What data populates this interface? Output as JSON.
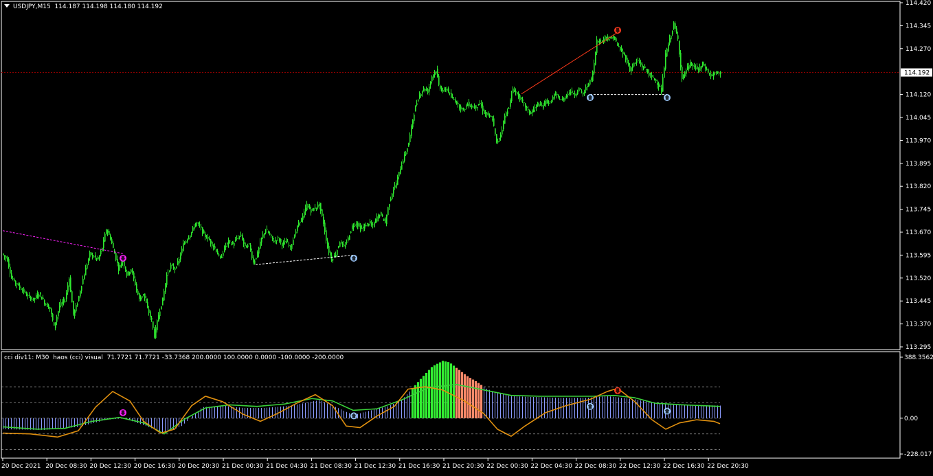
{
  "colors": {
    "background": "#000000",
    "frame": "#ffffff",
    "bull_candle": "#2ee82e",
    "bear_candle": "#2ee82e",
    "price_line": "#8b0000",
    "price_label_bg": "#ffffff",
    "price_label_fg": "#000000",
    "down_arrow_red": "#ff3b1f",
    "down_arrow_magenta": "#ff22ff",
    "up_arrow_blue": "#9ecbff",
    "hist_neutral": "#8c9cff",
    "hist_bull": "#33ee33",
    "hist_bear": "#ff8a6a",
    "cci_line": "#e0900f",
    "signal_line": "#3ad13a",
    "level_line": "#c8c8c8",
    "trend_red": "#ff3a1a",
    "trend_magenta": "#ff22ff",
    "trend_white": "#ffffff"
  },
  "main_header": {
    "symbol_tf": "USDJPY,M15",
    "ohlc": "114.187 114.198 114.180 114.192"
  },
  "indicator_header": {
    "text": "cci div11: M30  haos (cci) visual  71.7721 71.7721 -33.7368 200.0000 100.0000 0.0000 -100.0000 -200.0000"
  },
  "chart_data": [
    {
      "type": "candlestick",
      "symbol": "USDJPY",
      "timeframe": "M15",
      "y_ticks": [
        "114.420",
        "114.345",
        "114.270",
        "114.120",
        "114.045",
        "113.970",
        "113.895",
        "113.820",
        "113.745",
        "113.670",
        "113.595",
        "113.520",
        "113.445",
        "113.370",
        "113.295"
      ],
      "ylim": [
        113.295,
        114.42
      ],
      "current_price": "114.192",
      "x_ticks": [
        "20 Dec 2021",
        "20 Dec 08:30",
        "20 Dec 12:30",
        "20 Dec 16:30",
        "20 Dec 20:30",
        "21 Dec 00:30",
        "21 Dec 04:30",
        "21 Dec 08:30",
        "21 Dec 12:30",
        "21 Dec 16:30",
        "21 Dec 20:30",
        "22 Dec 00:30",
        "22 Dec 04:30",
        "22 Dec 08:30",
        "22 Dec 12:30",
        "22 Dec 16:30",
        "22 Dec 20:30"
      ],
      "price_path": [
        [
          0,
          113.6
        ],
        [
          8,
          113.58
        ],
        [
          14,
          113.52
        ],
        [
          22,
          113.5
        ],
        [
          30,
          113.48
        ],
        [
          38,
          113.46
        ],
        [
          46,
          113.45
        ],
        [
          54,
          113.47
        ],
        [
          62,
          113.44
        ],
        [
          70,
          113.42
        ],
        [
          76,
          113.36
        ],
        [
          84,
          113.43
        ],
        [
          92,
          113.45
        ],
        [
          98,
          113.52
        ],
        [
          104,
          113.4
        ],
        [
          110,
          113.44
        ],
        [
          116,
          113.5
        ],
        [
          122,
          113.55
        ],
        [
          128,
          113.6
        ],
        [
          134,
          113.59
        ],
        [
          140,
          113.58
        ],
        [
          146,
          113.62
        ],
        [
          152,
          113.68
        ],
        [
          158,
          113.65
        ],
        [
          164,
          113.6
        ],
        [
          170,
          113.55
        ],
        [
          176,
          113.58
        ],
        [
          182,
          113.53
        ],
        [
          188,
          113.55
        ],
        [
          194,
          113.5
        ],
        [
          200,
          113.45
        ],
        [
          206,
          113.47
        ],
        [
          212,
          113.42
        ],
        [
          218,
          113.38
        ],
        [
          222,
          113.33
        ],
        [
          228,
          113.4
        ],
        [
          234,
          113.45
        ],
        [
          240,
          113.53
        ],
        [
          246,
          113.56
        ],
        [
          252,
          113.55
        ],
        [
          258,
          113.58
        ],
        [
          264,
          113.63
        ],
        [
          270,
          113.65
        ],
        [
          276,
          113.67
        ],
        [
          282,
          113.7
        ],
        [
          288,
          113.69
        ],
        [
          294,
          113.66
        ],
        [
          300,
          113.65
        ],
        [
          306,
          113.63
        ],
        [
          312,
          113.61
        ],
        [
          318,
          113.58
        ],
        [
          324,
          113.62
        ],
        [
          330,
          113.64
        ],
        [
          336,
          113.63
        ],
        [
          342,
          113.65
        ],
        [
          348,
          113.66
        ],
        [
          354,
          113.62
        ],
        [
          360,
          113.63
        ],
        [
          366,
          113.57
        ],
        [
          372,
          113.6
        ],
        [
          378,
          113.65
        ],
        [
          384,
          113.68
        ],
        [
          390,
          113.66
        ],
        [
          396,
          113.64
        ],
        [
          402,
          113.65
        ],
        [
          408,
          113.63
        ],
        [
          414,
          113.64
        ],
        [
          420,
          113.62
        ],
        [
          426,
          113.66
        ],
        [
          432,
          113.7
        ],
        [
          438,
          113.72
        ],
        [
          444,
          113.76
        ],
        [
          450,
          113.74
        ],
        [
          456,
          113.75
        ],
        [
          462,
          113.76
        ],
        [
          468,
          113.7
        ],
        [
          474,
          113.62
        ],
        [
          480,
          113.58
        ],
        [
          486,
          113.6
        ],
        [
          492,
          113.64
        ],
        [
          498,
          113.62
        ],
        [
          504,
          113.65
        ],
        [
          510,
          113.69
        ],
        [
          516,
          113.7
        ],
        [
          522,
          113.68
        ],
        [
          528,
          113.69
        ],
        [
          534,
          113.7
        ],
        [
          540,
          113.69
        ],
        [
          546,
          113.72
        ],
        [
          552,
          113.73
        ],
        [
          558,
          113.7
        ],
        [
          562,
          113.75
        ],
        [
          568,
          113.8
        ],
        [
          574,
          113.83
        ],
        [
          580,
          113.88
        ],
        [
          586,
          113.92
        ],
        [
          592,
          113.96
        ],
        [
          598,
          114.04
        ],
        [
          602,
          114.08
        ],
        [
          608,
          114.12
        ],
        [
          614,
          114.14
        ],
        [
          620,
          114.13
        ],
        [
          626,
          114.18
        ],
        [
          632,
          114.2
        ],
        [
          636,
          114.15
        ],
        [
          642,
          114.13
        ],
        [
          648,
          114.14
        ],
        [
          654,
          114.11
        ],
        [
          660,
          114.1
        ],
        [
          666,
          114.08
        ],
        [
          672,
          114.07
        ],
        [
          678,
          114.09
        ],
        [
          684,
          114.08
        ],
        [
          690,
          114.08
        ],
        [
          696,
          114.09
        ],
        [
          702,
          114.06
        ],
        [
          708,
          114.05
        ],
        [
          714,
          114.04
        ],
        [
          720,
          113.96
        ],
        [
          726,
          113.99
        ],
        [
          732,
          114.05
        ],
        [
          738,
          114.08
        ],
        [
          744,
          114.14
        ],
        [
          750,
          114.12
        ],
        [
          756,
          114.1
        ],
        [
          762,
          114.08
        ],
        [
          768,
          114.06
        ],
        [
          774,
          114.07
        ],
        [
          780,
          114.09
        ],
        [
          786,
          114.08
        ],
        [
          792,
          114.1
        ],
        [
          798,
          114.09
        ],
        [
          804,
          114.12
        ],
        [
          810,
          114.11
        ],
        [
          816,
          114.1
        ],
        [
          822,
          114.12
        ],
        [
          828,
          114.13
        ],
        [
          834,
          114.12
        ],
        [
          840,
          114.14
        ],
        [
          846,
          114.12
        ],
        [
          852,
          114.15
        ],
        [
          858,
          114.17
        ],
        [
          862,
          114.22
        ],
        [
          866,
          114.3
        ],
        [
          872,
          114.29
        ],
        [
          878,
          114.31
        ],
        [
          884,
          114.3
        ],
        [
          890,
          114.31
        ],
        [
          896,
          114.28
        ],
        [
          902,
          114.26
        ],
        [
          908,
          114.24
        ],
        [
          914,
          114.2
        ],
        [
          920,
          114.22
        ],
        [
          926,
          114.23
        ],
        [
          932,
          114.21
        ],
        [
          938,
          114.2
        ],
        [
          944,
          114.18
        ],
        [
          950,
          114.17
        ],
        [
          956,
          114.15
        ],
        [
          960,
          114.13
        ],
        [
          966,
          114.25
        ],
        [
          972,
          114.3
        ],
        [
          978,
          114.35
        ],
        [
          984,
          114.3
        ],
        [
          990,
          114.17
        ],
        [
          996,
          114.2
        ],
        [
          1002,
          114.22
        ],
        [
          1008,
          114.21
        ],
        [
          1014,
          114.2
        ],
        [
          1020,
          114.22
        ],
        [
          1026,
          114.2
        ],
        [
          1032,
          114.18
        ],
        [
          1038,
          114.19
        ],
        [
          1044,
          114.19
        ]
      ],
      "arrows": [
        {
          "kind": "down",
          "color": "down_arrow_magenta",
          "bar": 175,
          "price": 113.585
        },
        {
          "kind": "up",
          "color": "up_arrow_blue",
          "bar": 511,
          "price": 113.585
        },
        {
          "kind": "up",
          "color": "up_arrow_blue",
          "bar": 855,
          "price": 114.11
        },
        {
          "kind": "down",
          "color": "down_arrow_red",
          "bar": 895,
          "price": 114.33
        },
        {
          "kind": "up",
          "color": "up_arrow_blue",
          "bar": 967,
          "price": 114.11
        }
      ],
      "trend_lines": [
        {
          "color": "trend_magenta",
          "dashed": true,
          "from": [
            0,
            113.675
          ],
          "to": [
            175,
            113.6
          ]
        },
        {
          "color": "trend_white",
          "dashed": true,
          "from": [
            368,
            113.564
          ],
          "to": [
            511,
            113.595
          ]
        },
        {
          "color": "trend_red",
          "dashed": false,
          "from": [
            755,
            114.122
          ],
          "to": [
            895,
            114.323
          ]
        },
        {
          "color": "trend_white",
          "dashed": true,
          "from": [
            855,
            114.12
          ],
          "to": [
            967,
            114.12
          ]
        }
      ]
    },
    {
      "type": "bar",
      "name": "cci div11: M30",
      "y_ticks": [
        "388.3562",
        "0.00",
        "-228.017"
      ],
      "ylim": [
        -228.017,
        388.3562
      ],
      "levels": [
        200,
        100,
        0,
        -100,
        -200
      ],
      "histogram": [
        [
          0,
          -70
        ],
        [
          60,
          -75
        ],
        [
          110,
          -55
        ],
        [
          150,
          -10
        ],
        [
          175,
          0
        ],
        [
          205,
          -45
        ],
        [
          235,
          -95
        ],
        [
          260,
          -50
        ],
        [
          290,
          70
        ],
        [
          320,
          80
        ],
        [
          350,
          65
        ],
        [
          380,
          65
        ],
        [
          420,
          80
        ],
        [
          460,
          115
        ],
        [
          480,
          80
        ],
        [
          510,
          20
        ],
        [
          540,
          55
        ],
        [
          560,
          75
        ],
        [
          580,
          115
        ],
        [
          592,
          170
        ],
        [
          610,
          260
        ],
        [
          625,
          330
        ],
        [
          640,
          365
        ],
        [
          650,
          355
        ],
        [
          660,
          320
        ],
        [
          675,
          270
        ],
        [
          690,
          230
        ],
        [
          705,
          185
        ],
        [
          720,
          160
        ],
        [
          740,
          140
        ],
        [
          770,
          135
        ],
        [
          810,
          130
        ],
        [
          850,
          130
        ],
        [
          880,
          140
        ],
        [
          900,
          130
        ],
        [
          920,
          120
        ],
        [
          945,
          100
        ],
        [
          970,
          85
        ],
        [
          1000,
          85
        ],
        [
          1044,
          80
        ]
      ],
      "hist_bull_range": [
        594,
        657
      ],
      "hist_bear_range": [
        657,
        697
      ],
      "cci_line": [
        [
          0,
          -95
        ],
        [
          40,
          -100
        ],
        [
          80,
          -120
        ],
        [
          110,
          -80
        ],
        [
          135,
          70
        ],
        [
          160,
          170
        ],
        [
          185,
          110
        ],
        [
          205,
          -20
        ],
        [
          230,
          -95
        ],
        [
          250,
          -70
        ],
        [
          275,
          80
        ],
        [
          295,
          140
        ],
        [
          320,
          105
        ],
        [
          350,
          25
        ],
        [
          375,
          -20
        ],
        [
          400,
          30
        ],
        [
          430,
          100
        ],
        [
          455,
          150
        ],
        [
          480,
          80
        ],
        [
          500,
          -50
        ],
        [
          520,
          -60
        ],
        [
          545,
          15
        ],
        [
          570,
          75
        ],
        [
          590,
          185
        ],
        [
          615,
          200
        ],
        [
          640,
          180
        ],
        [
          670,
          115
        ],
        [
          700,
          30
        ],
        [
          720,
          -70
        ],
        [
          740,
          -115
        ],
        [
          760,
          -50
        ],
        [
          790,
          35
        ],
        [
          820,
          80
        ],
        [
          855,
          120
        ],
        [
          880,
          170
        ],
        [
          895,
          190
        ],
        [
          920,
          105
        ],
        [
          945,
          -10
        ],
        [
          965,
          -70
        ],
        [
          985,
          -30
        ],
        [
          1010,
          -10
        ],
        [
          1035,
          -20
        ],
        [
          1044,
          -35
        ]
      ],
      "signal_line": [
        [
          0,
          -55
        ],
        [
          50,
          -70
        ],
        [
          90,
          -65
        ],
        [
          130,
          -20
        ],
        [
          170,
          5
        ],
        [
          205,
          -30
        ],
        [
          235,
          -100
        ],
        [
          265,
          -5
        ],
        [
          295,
          65
        ],
        [
          330,
          85
        ],
        [
          370,
          75
        ],
        [
          410,
          90
        ],
        [
          450,
          125
        ],
        [
          480,
          110
        ],
        [
          510,
          50
        ],
        [
          545,
          60
        ],
        [
          580,
          115
        ],
        [
          620,
          195
        ],
        [
          660,
          215
        ],
        [
          700,
          180
        ],
        [
          740,
          145
        ],
        [
          780,
          140
        ],
        [
          820,
          140
        ],
        [
          860,
          140
        ],
        [
          890,
          145
        ],
        [
          920,
          130
        ],
        [
          950,
          95
        ],
        [
          990,
          85
        ],
        [
          1044,
          75
        ]
      ],
      "arrows": [
        {
          "kind": "down",
          "color": "down_arrow_magenta",
          "bar": 175,
          "value": 35
        },
        {
          "kind": "up",
          "color": "up_arrow_blue",
          "bar": 511,
          "value": 15
        },
        {
          "kind": "up",
          "color": "up_arrow_blue",
          "bar": 855,
          "value": 75
        },
        {
          "kind": "down",
          "color": "down_arrow_red",
          "bar": 895,
          "value": 175
        },
        {
          "kind": "up",
          "color": "up_arrow_blue",
          "bar": 967,
          "value": 45
        }
      ]
    }
  ]
}
